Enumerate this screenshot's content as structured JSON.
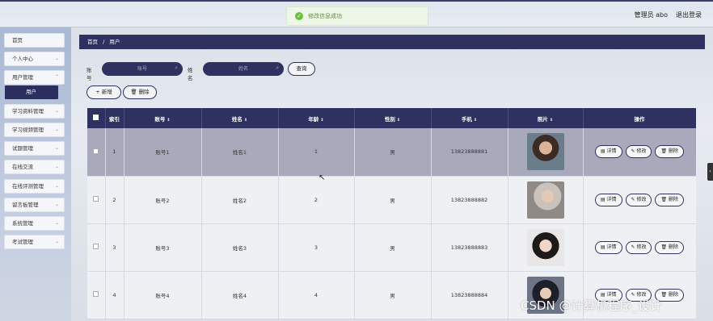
{
  "header": {
    "user_label": "管理员 abo",
    "logout_label": "退出登录"
  },
  "toast": {
    "message": "修改信息成功"
  },
  "sidebar": {
    "items": [
      {
        "label": "首页",
        "chev": ""
      },
      {
        "label": "个人中心",
        "chev": "⌄"
      },
      {
        "label": "用户管理",
        "chev": "⌃"
      },
      {
        "label": "学习资料管理",
        "chev": "⌄"
      },
      {
        "label": "学习视频管理",
        "chev": "⌄"
      },
      {
        "label": "试题管理",
        "chev": "⌄"
      },
      {
        "label": "在线交流",
        "chev": "⌄"
      },
      {
        "label": "在线评测管理",
        "chev": "⌄"
      },
      {
        "label": "留言板管理",
        "chev": "⌄"
      },
      {
        "label": "系统管理",
        "chev": "⌄"
      },
      {
        "label": "考试管理",
        "chev": "⌄"
      }
    ],
    "active_sub": "用户"
  },
  "breadcrumb": {
    "home": "首页",
    "sep": "/",
    "current": "用户"
  },
  "search": {
    "account_label": "账号",
    "account_placeholder": "账号",
    "name_label": "姓名",
    "name_placeholder": "姓名",
    "query_button": "查询"
  },
  "actions": {
    "add": "+ 新增",
    "delete": "🗑 删除"
  },
  "table": {
    "headers": [
      "索引",
      "账号",
      "姓名",
      "年龄",
      "性别",
      "手机",
      "照片",
      "操作"
    ],
    "rows": [
      {
        "index": "1",
        "account": "账号1",
        "name": "姓名1",
        "age": "1",
        "gender": "男",
        "phone": "13823888881"
      },
      {
        "index": "2",
        "account": "账号2",
        "name": "姓名2",
        "age": "2",
        "gender": "男",
        "phone": "13823888882"
      },
      {
        "index": "3",
        "account": "账号3",
        "name": "姓名3",
        "age": "3",
        "gender": "男",
        "phone": "13823888883"
      },
      {
        "index": "4",
        "account": "账号4",
        "name": "姓名4",
        "age": "4",
        "gender": "男",
        "phone": "13823888884"
      }
    ],
    "op_labels": {
      "detail": "▤ 详情",
      "edit": "✎ 修改",
      "delete": "🗑 删除"
    }
  },
  "watermark": "CSDN @计算机程序_设计",
  "colors": {
    "primary": "#2f3261",
    "success": "#67c23a"
  }
}
